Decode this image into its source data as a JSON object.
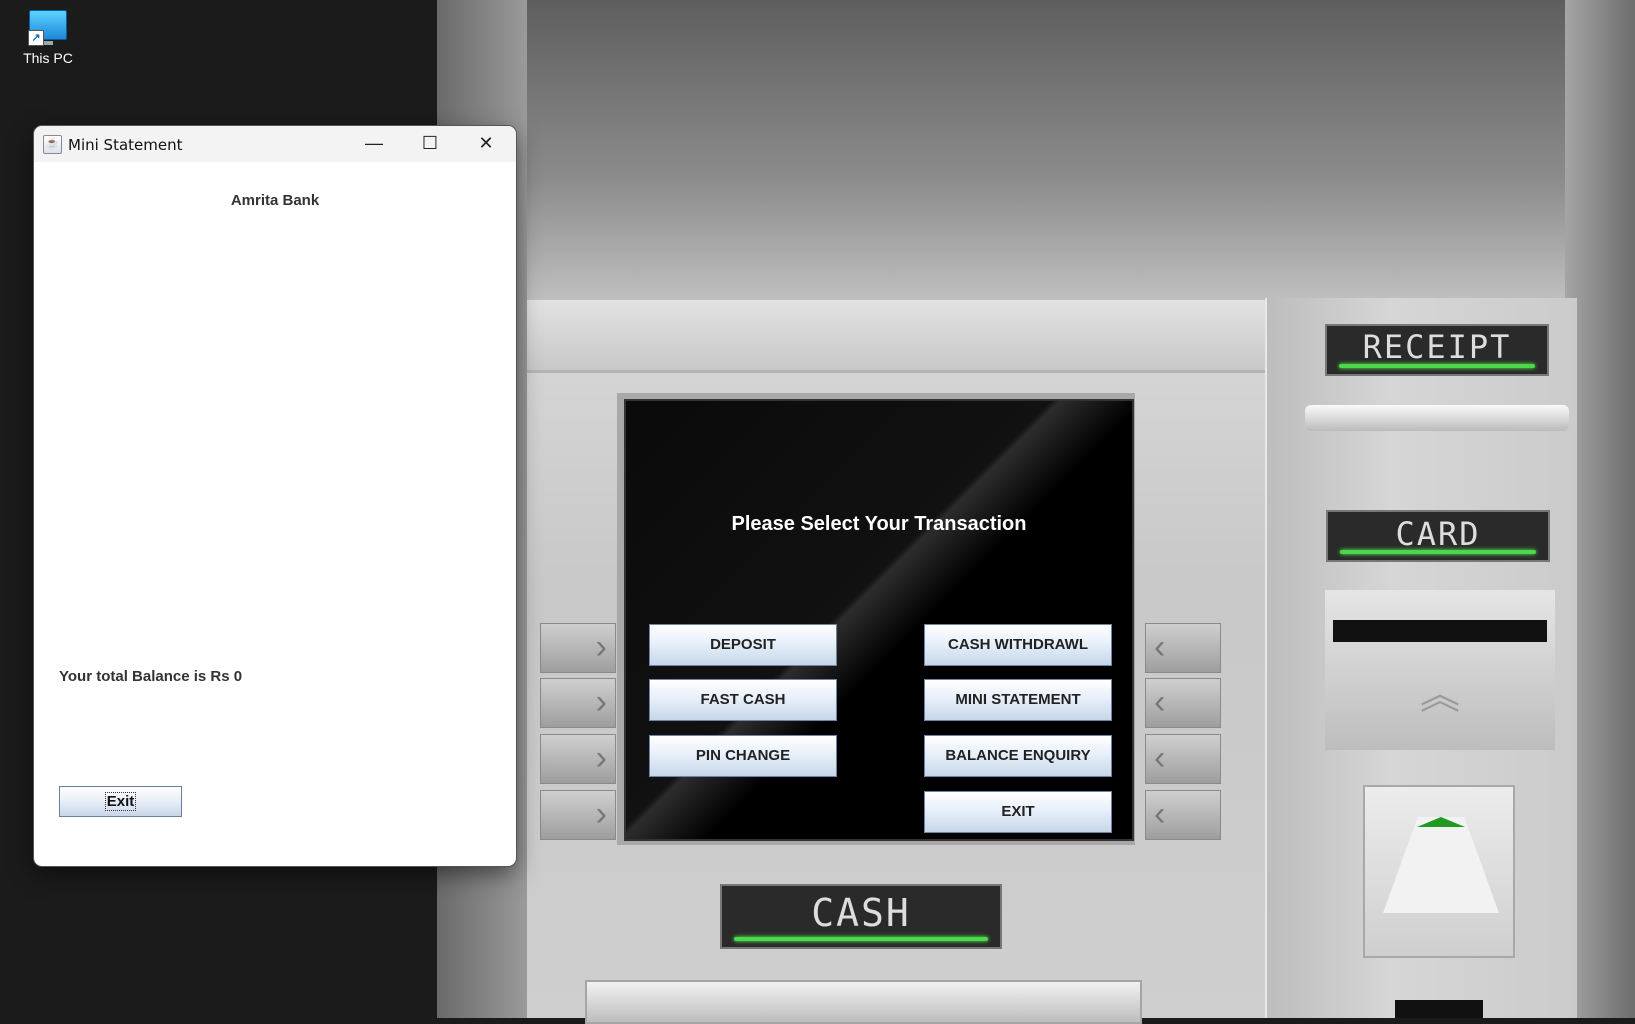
{
  "desktop": {
    "icon_label": "This PC"
  },
  "atm": {
    "screen_title": "Please Select Your Transaction",
    "buttons": {
      "deposit": "DEPOSIT",
      "cash_withdrawl": "CASH WITHDRAWL",
      "fast_cash": "FAST CASH",
      "mini_statement": "MINI STATEMENT",
      "pin_change": "PIN CHANGE",
      "balance_enquiry": "BALANCE ENQUIRY",
      "exit": "EXIT"
    },
    "labels": {
      "receipt": "RECEIPT",
      "card": "CARD",
      "cash": "CASH"
    },
    "led_color": "#4bd84b"
  },
  "window": {
    "title": "Mini Statement",
    "bank_name": "Amrita Bank",
    "balance_text": "Your total Balance is Rs 0",
    "exit_label": "Exit"
  }
}
